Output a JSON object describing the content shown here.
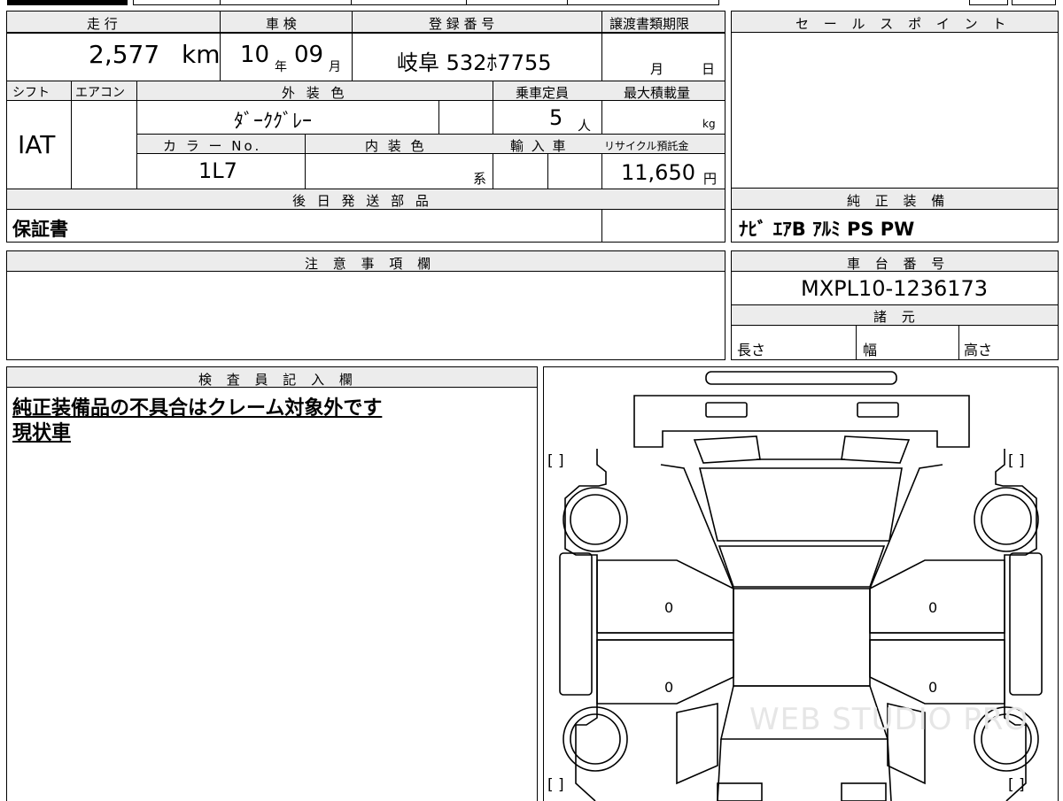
{
  "main_table": {
    "mileage_label": "走 行",
    "mileage_value": "2,577",
    "mileage_unit": "km",
    "inspection_label": "車 検",
    "inspection_year": "10",
    "inspection_year_unit": "年",
    "inspection_month": "09",
    "inspection_month_unit": "月",
    "registration_label": "登 録 番 号",
    "registration_value": "岐阜 532ﾎ7755",
    "transfer_label": "譲渡書類期限",
    "transfer_month_unit": "月",
    "transfer_day_unit": "日",
    "shift_label": "シフト",
    "ac_label": "エアコン",
    "exterior_label": "外 装 色",
    "capacity_label": "乗車定員",
    "max_load_label": "最大積載量",
    "shift_value": "IAT",
    "exterior_value": "ﾀﾞｰｸｸﾞﾚｰ",
    "capacity_value": "5",
    "capacity_unit": "人",
    "max_load_unit": "kg",
    "color_no_label": "カ ラ ー No.",
    "interior_label": "内 装 色",
    "import_label": "輸 入 車",
    "recycle_label": "リサイクル預託金",
    "color_no_value": "1L7",
    "interior_unit": "系",
    "recycle_value": "11,650",
    "recycle_unit": "円",
    "later_parts_label": "後 日 発 送 部 品",
    "later_parts_value": "保証書"
  },
  "sales_point": {
    "label": "セ ー ル ス ポ イ ン ト"
  },
  "genuine_equipment": {
    "label": "純 正 装 備",
    "value": "ﾅﾋﾞ ｴｱB ｱﾙﾐ PS PW"
  },
  "notes": {
    "label": "注 意 事 項 欄"
  },
  "chassis": {
    "label": "車 台 番 号",
    "value": "MXPL10-1236173",
    "specs_label": "諸 元",
    "length_label": "長さ",
    "width_label": "幅",
    "height_label": "高さ"
  },
  "inspector": {
    "label": "検 査 員 記 入 欄",
    "line1": "純正装備品の不具合はクレーム対象外です",
    "line2": "現状車"
  },
  "diagram": {
    "bracket_tl": "[      ]",
    "bracket_tr": "[      ]",
    "bracket_bl": "[      ]",
    "bracket_br": "[      ]",
    "door_mark_fl": "0",
    "door_mark_rl": "0",
    "door_mark_fr": "0",
    "door_mark_rr": "0",
    "watermark": "WEB STUDIO PRO"
  }
}
